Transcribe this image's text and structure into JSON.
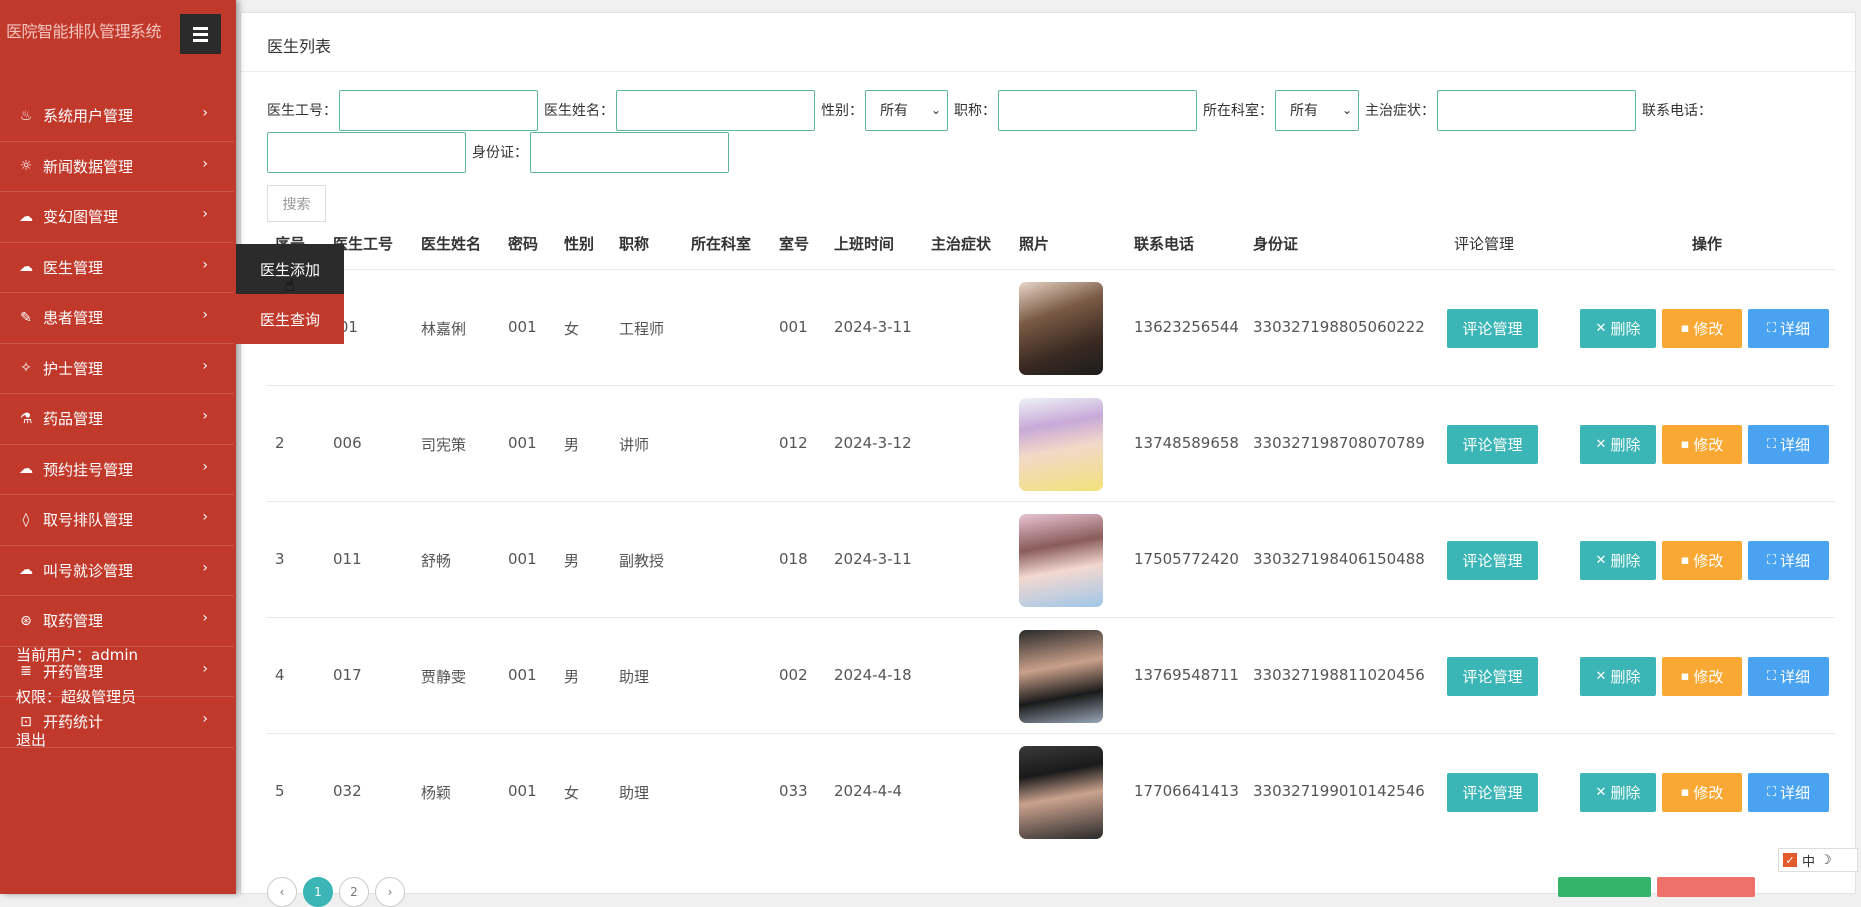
{
  "app": {
    "title": "医院智能排队管理系统"
  },
  "sidebar": {
    "items": [
      {
        "label": "系统用户管理",
        "icon": "palette-icon",
        "glyph": "♨"
      },
      {
        "label": "新闻数据管理",
        "icon": "sun-icon",
        "glyph": "☼"
      },
      {
        "label": "变幻图管理",
        "icon": "cloud-icon",
        "glyph": "☁"
      },
      {
        "label": "医生管理",
        "icon": "cloud-upload-icon",
        "glyph": "☁"
      },
      {
        "label": "患者管理",
        "icon": "pencil-icon",
        "glyph": "✎"
      },
      {
        "label": "护士管理",
        "icon": "magic-wand-icon",
        "glyph": "✧"
      },
      {
        "label": "药品管理",
        "icon": "flask-icon",
        "glyph": "⚗"
      },
      {
        "label": "预约挂号管理",
        "icon": "cloud-download-icon",
        "glyph": "☁"
      },
      {
        "label": "取号排队管理",
        "icon": "drop-icon",
        "glyph": "◊"
      },
      {
        "label": "叫号就诊管理",
        "icon": "cloud-icon",
        "glyph": "☁"
      },
      {
        "label": "取药管理",
        "icon": "money-icon",
        "glyph": "⊛"
      },
      {
        "label": "开药管理",
        "icon": "database-icon",
        "glyph": "≣"
      },
      {
        "label": "开药统计",
        "icon": "lock-icon",
        "glyph": "⊡"
      }
    ],
    "current_user": "当前用户：admin",
    "permission": "权限：超级管理员",
    "logout": "退出",
    "chevron": "›"
  },
  "submenu": {
    "items": [
      {
        "label": "医生添加"
      },
      {
        "label": "医生查询"
      }
    ]
  },
  "panel": {
    "title": "医生列表"
  },
  "search": {
    "doctor_id_label": "医生工号：",
    "doctor_name_label": "医生姓名：",
    "gender_label": "性别：",
    "gender_value": "所有",
    "title_label": "职称：",
    "dept_label": "所在科室：",
    "dept_value": "所有",
    "symptom_label": "主治症状：",
    "phone_label": "联系电话：",
    "id_card_label": "身份证：",
    "button": "搜索"
  },
  "table": {
    "headers": {
      "index": "序号",
      "doctor_id": "医生工号",
      "doctor_name": "医生姓名",
      "password": "密码",
      "gender": "性别",
      "title": "职称",
      "dept": "所在科室",
      "room": "室号",
      "shift": "上班时间",
      "symptom": "主治症状",
      "photo": "照片",
      "phone": "联系电话",
      "id_card": "身份证",
      "review": "评论管理",
      "ops": "操作"
    },
    "rows": [
      {
        "index": "",
        "doctor_id": ")01",
        "doctor_name": "林嘉俐",
        "password": "001",
        "gender": "女",
        "title": "工程师",
        "dept": "",
        "room": "001",
        "shift": "2024-3-11",
        "symptom": "",
        "phone": "13623256544",
        "id_card": "330327198805060222"
      },
      {
        "index": "2",
        "doctor_id": "006",
        "doctor_name": "司宪策",
        "password": "001",
        "gender": "男",
        "title": "讲师",
        "dept": "",
        "room": "012",
        "shift": "2024-3-12",
        "symptom": "",
        "phone": "13748589658",
        "id_card": "330327198708070789"
      },
      {
        "index": "3",
        "doctor_id": "011",
        "doctor_name": "舒畅",
        "password": "001",
        "gender": "男",
        "title": "副教授",
        "dept": "",
        "room": "018",
        "shift": "2024-3-11",
        "symptom": "",
        "phone": "17505772420",
        "id_card": "330327198406150488"
      },
      {
        "index": "4",
        "doctor_id": "017",
        "doctor_name": "贾静雯",
        "password": "001",
        "gender": "男",
        "title": "助理",
        "dept": "",
        "room": "002",
        "shift": "2024-4-18",
        "symptom": "",
        "phone": "13769548711",
        "id_card": "330327198811020456"
      },
      {
        "index": "5",
        "doctor_id": "032",
        "doctor_name": "杨颖",
        "password": "001",
        "gender": "女",
        "title": "助理",
        "dept": "",
        "room": "033",
        "shift": "2024-4-4",
        "symptom": "",
        "phone": "17706641413",
        "id_card": "330327199010142546"
      }
    ],
    "buttons": {
      "review": "评论管理",
      "delete": "删除",
      "edit": "修改",
      "detail": "详细"
    }
  },
  "pager": {
    "prev": "‹",
    "pages": [
      "1",
      "2"
    ],
    "next": "›"
  },
  "ime": {
    "lang": "中",
    "moon": "☽"
  },
  "colors": {
    "sidebar": "#c0392b",
    "teal": "#3bb5b5",
    "orange": "#f8a833",
    "blue": "#4aa3f0"
  }
}
